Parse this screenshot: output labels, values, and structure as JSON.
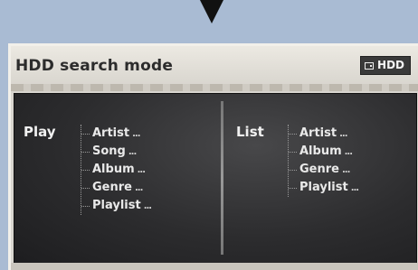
{
  "screen": {
    "title": "HDD search mode",
    "source_badge": "HDD",
    "source_icon": "hdd-icon"
  },
  "play": {
    "heading": "Play",
    "items": [
      {
        "label": "Artist",
        "suffix": "..."
      },
      {
        "label": "Song",
        "suffix": "..."
      },
      {
        "label": "Album",
        "suffix": "..."
      },
      {
        "label": "Genre",
        "suffix": "..."
      },
      {
        "label": "Playlist",
        "suffix": "..."
      }
    ]
  },
  "list": {
    "heading": "List",
    "items": [
      {
        "label": "Artist",
        "suffix": "..."
      },
      {
        "label": "Album",
        "suffix": "..."
      },
      {
        "label": "Genre",
        "suffix": "..."
      },
      {
        "label": "Playlist",
        "suffix": "..."
      }
    ]
  },
  "colors": {
    "background": "#a9bbd3",
    "panel": "#2c2c2e",
    "text": "#e9e9e9"
  }
}
